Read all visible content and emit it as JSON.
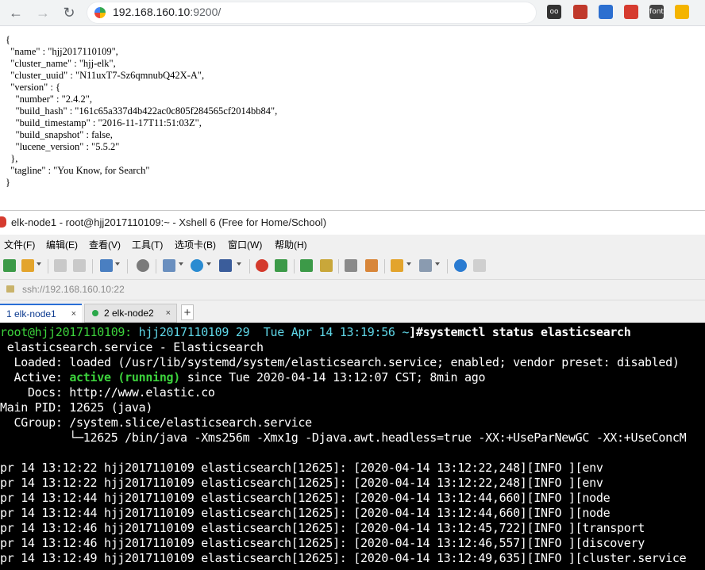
{
  "browser": {
    "url_host": "192.168.160.10",
    "url_rest": ":9200/",
    "extensions": [
      {
        "icon": "ext-owl-icon",
        "label": "oo",
        "color": "#333333"
      },
      {
        "icon": "ext-red-icon",
        "label": "",
        "color": "#c0392b"
      },
      {
        "icon": "ext-bird-icon",
        "label": "",
        "color": "#2c6fd0"
      },
      {
        "icon": "ext-red2-icon",
        "label": "",
        "color": "#d63b2f"
      },
      {
        "icon": "ext-font-icon",
        "label": "font",
        "color": "#444444"
      },
      {
        "icon": "ext-chrome-icon",
        "label": "",
        "color": "#f4b400"
      }
    ]
  },
  "json_text": "{\n  \"name\" : \"hjj2017110109\",\n  \"cluster_name\" : \"hjj-elk\",\n  \"cluster_uuid\" : \"N11uxT7-Sz6qmnubQ42X-A\",\n  \"version\" : {\n    \"number\" : \"2.4.2\",\n    \"build_hash\" : \"161c65a337d4b422ac0c805f284565cf2014bb84\",\n    \"build_timestamp\" : \"2016-11-17T11:51:03Z\",\n    \"build_snapshot\" : false,\n    \"lucene_version\" : \"5.5.2\"\n  },\n  \"tagline\" : \"You Know, for Search\"\n}",
  "xshell": {
    "title": "elk-node1 - root@hjj2017110109:~ - Xshell 6 (Free for Home/School)",
    "menu": [
      "文件(F)",
      "编辑(E)",
      "查看(V)",
      "工具(T)",
      "选项卡(B)",
      "窗口(W)",
      "帮助(H)"
    ],
    "address": "ssh://192.168.160.10:22",
    "tabs": [
      {
        "label": "1 elk-node1",
        "close": "×"
      },
      {
        "label": "2 elk-node2",
        "close": "×"
      }
    ],
    "tab_add": "+"
  },
  "terminal": {
    "prompt_user": "root@hjj2017110109:",
    "prompt_path": " hjj2017110109 29  Tue Apr 14 13:19:56 ~",
    "prompt_cmd": "]#systemctl status elasticsearch",
    "service_line": " elasticsearch.service - Elasticsearch",
    "loaded_line": "  Loaded: loaded (/usr/lib/systemd/system/elasticsearch.service; enabled; vendor preset: disabled)",
    "active_label": "  Active: ",
    "active_status": "active (running)",
    "active_rest": " since Tue 2020-04-14 13:12:07 CST; 8min ago",
    "docs_line": "    Docs: http://www.elastic.co",
    "pid_line": "Main PID: 12625 (java)",
    "cgroup_line": "  CGroup: /system.slice/elasticsearch.service",
    "cgroup_child": "          └─12625 /bin/java -Xms256m -Xmx1g -Djava.awt.headless=true -XX:+UseParNewGC -XX:+UseConcM",
    "logs": [
      "pr 14 13:12:22 hjj2017110109 elasticsearch[12625]: [2020-04-14 13:12:22,248][INFO ][env",
      "pr 14 13:12:22 hjj2017110109 elasticsearch[12625]: [2020-04-14 13:12:22,248][INFO ][env",
      "pr 14 13:12:44 hjj2017110109 elasticsearch[12625]: [2020-04-14 13:12:44,660][INFO ][node",
      "pr 14 13:12:44 hjj2017110109 elasticsearch[12625]: [2020-04-14 13:12:44,660][INFO ][node",
      "pr 14 13:12:46 hjj2017110109 elasticsearch[12625]: [2020-04-14 13:12:45,722][INFO ][transport",
      "pr 14 13:12:46 hjj2017110109 elasticsearch[12625]: [2020-04-14 13:12:46,557][INFO ][discovery",
      "pr 14 13:12:49 hjj2017110109 elasticsearch[12625]: [2020-04-14 13:12:49,635][INFO ][cluster.service"
    ]
  }
}
